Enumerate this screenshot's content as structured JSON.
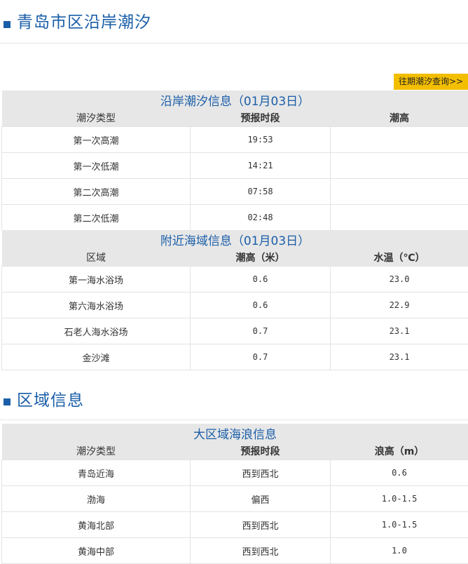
{
  "section1": {
    "title": "青岛市区沿岸潮汐"
  },
  "history_link": "往期潮汐查询>>",
  "tide_table": {
    "caption": "沿岸潮汐信息（01月03日）",
    "headers": [
      "潮汐类型",
      "预报时段",
      "潮高"
    ],
    "rows": [
      [
        "第一次高潮",
        "19:53",
        ""
      ],
      [
        "第一次低潮",
        "14:21",
        ""
      ],
      [
        "第二次高潮",
        "07:58",
        ""
      ],
      [
        "第二次低潮",
        "02:48",
        ""
      ]
    ]
  },
  "sea_table": {
    "caption": "附近海域信息（01月03日）",
    "headers": [
      "区域",
      "潮高（米）",
      "水温（℃）"
    ],
    "rows": [
      [
        "第一海水浴场",
        "0.6",
        "23.0"
      ],
      [
        "第六海水浴场",
        "0.6",
        "22.9"
      ],
      [
        "石老人海水浴场",
        "0.7",
        "23.1"
      ],
      [
        "金沙滩",
        "0.7",
        "23.1"
      ]
    ]
  },
  "section2": {
    "title": "区域信息"
  },
  "wave_table": {
    "caption": "大区域海浪信息",
    "headers": [
      "潮汐类型",
      "预报时段",
      "浪高（m）"
    ],
    "rows": [
      [
        "青岛近海",
        "西到西北",
        "0.6"
      ],
      [
        "渤海",
        "偏西",
        "1.0-1.5"
      ],
      [
        "黄海北部",
        "西到西北",
        "1.0-1.5"
      ],
      [
        "黄海中部",
        "西到西北",
        "1.0"
      ]
    ]
  },
  "colors": {
    "accent": "#1a5ea8",
    "button": "#f3be00",
    "header_bg": "#e7e7e7"
  }
}
